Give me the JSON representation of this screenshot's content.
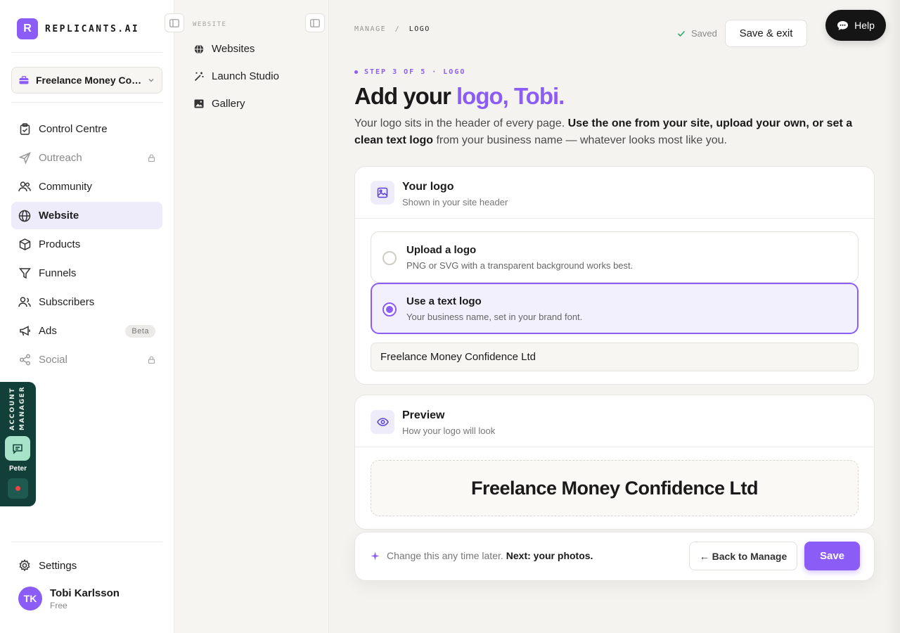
{
  "brand": {
    "mark": "R",
    "name": "REPLICANTS.AI"
  },
  "workspace": {
    "name": "Freelance Money Confidence Ltd"
  },
  "nav": {
    "items": [
      {
        "label": "Control Centre"
      },
      {
        "label": "Outreach"
      },
      {
        "label": "Community"
      },
      {
        "label": "Website"
      },
      {
        "label": "Products"
      },
      {
        "label": "Funnels"
      },
      {
        "label": "Subscribers"
      },
      {
        "label": "Ads",
        "badge": "Beta"
      },
      {
        "label": "Social"
      }
    ]
  },
  "settings": {
    "label": "Settings"
  },
  "user": {
    "initials": "TK",
    "name": "Tobi Karlsson",
    "plan": "Free"
  },
  "account_manager": {
    "label": "ACCOUNT MANAGER",
    "name": "Peter"
  },
  "subnav": {
    "title": "WEBSITE",
    "items": [
      {
        "label": "Websites"
      },
      {
        "label": "Launch Studio"
      },
      {
        "label": "Gallery"
      }
    ]
  },
  "breadcrumb": {
    "parent": "MANAGE",
    "sep": "/",
    "current": "LOGO"
  },
  "status": {
    "saved": "Saved"
  },
  "header": {
    "save_exit": "Save & exit",
    "help": "Help"
  },
  "step": {
    "label": "STEP 3 OF 5 · LOGO"
  },
  "headline": {
    "lead": "Add your ",
    "accent": "logo, Tobi."
  },
  "intro": {
    "part1": "Your logo sits in the header of every page. ",
    "bold": "Use the one from your site, upload your own, or set a clean text logo",
    "part2": " from your business name — whatever looks most like you."
  },
  "logo_card": {
    "title": "Your logo",
    "subtitle": "Shown in your site header",
    "options": [
      {
        "title": "Upload a logo",
        "subtitle": "PNG or SVG with a transparent background works best.",
        "selected": false
      },
      {
        "title": "Use a text logo",
        "subtitle": "Your business name, set in your brand font.",
        "selected": true
      }
    ],
    "text_value": "Freelance Money Confidence Ltd"
  },
  "preview_card": {
    "title": "Preview",
    "subtitle": "How your logo will look",
    "logo_text": "Freelance Money Confidence Ltd"
  },
  "footer": {
    "note": "Change this any time later.",
    "next": "Next: your photos.",
    "back": "← Back to Manage",
    "save": "Save"
  },
  "colors": {
    "accent": "#8b5cf6",
    "active_bg": "#eeebfb",
    "manager_bg": "#124038"
  }
}
